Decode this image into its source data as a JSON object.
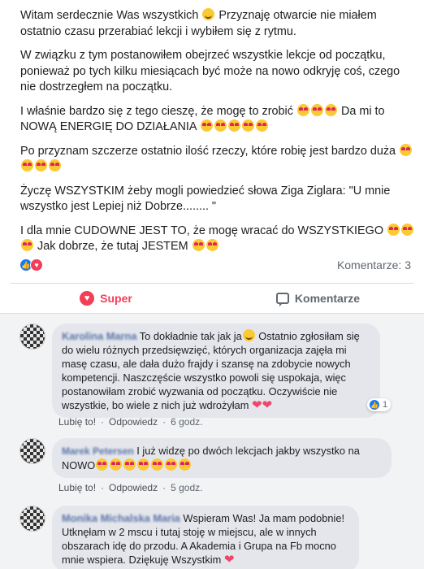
{
  "post": {
    "paragraphs": [
      {
        "before": "Witam serdecznie Was wszystkich ",
        "emoji": "smile",
        "after": " Przyznaję otwarcie nie miałem ostatnio czasu przerabiać lekcji i wybiłem się z rytmu."
      },
      {
        "text": "W związku z tym postanowiłem obejrzeć wszystkie lekcje od początku, ponieważ po tych kilku miesiącach być może na nowo odkryję coś, czego nie dostrzegłem na początku."
      },
      {
        "text": "I właśnie bardzo się z tego cieszę, że mogę to zrobić",
        "emoji_mid": "heart-eyes",
        "mid_count": 3,
        "text2": " Da mi to NOWĄ ENERGIĘ DO DZIAŁANIA ",
        "emoji_end": "heart-eyes",
        "end_count": 5
      },
      {
        "text": "Po przyznam szczerze ostatnio ilość rzeczy, które robię jest bardzo duża ",
        "emoji_end": "heart-eyes",
        "end_count": 4
      },
      {
        "text": "Życzę WSZYSTKIM żeby mogli powiedzieć słowa Ziga Ziglara: \"U mnie wszystko jest Lepiej niż Dobrze........ \""
      },
      {
        "text": "I dla mnie CUDOWNE JEST TO, że mogę wracać do WSZYSTKIEGO ",
        "emoji_mid": "heart-eyes",
        "mid_count": 3,
        "text2": " Jak dobrze, że tutaj JESTEM ",
        "emoji_end": "heart-eyes",
        "end_count": 2
      }
    ],
    "comments_count": "Komentarze: 3"
  },
  "actions": {
    "super_label": "Super",
    "comment_label": "Komentarze"
  },
  "comments": [
    {
      "name": "Karolina Marna",
      "text_before": "To dokładnie tak jak ja",
      "text_after": " Ostatnio zgłosiłam się do wielu różnych przedsięwzięć, których organizacja zajęła mi masę czasu, ale dała dużo frajdy i szansę na zdobycie nowych kompetencji. Naszczęście wszystko powoli się uspokaja, więc postanowiłam zrobić wyzwania od początku. Oczywiście nie wszystkie, bo wiele z nich już wdrożyłam",
      "trailing": "❤❤",
      "reaction_count": "1",
      "like": "Lubię to!",
      "reply": "Odpowiedz",
      "time": "6 godz."
    },
    {
      "name": "Marek Petersen",
      "text": "I już widzę po dwóch lekcjach jakby wszystko na NOWO",
      "emoji_count": 7,
      "like": "Lubię to!",
      "reply": "Odpowiedz",
      "time": "5 godz."
    },
    {
      "name": "Monika Michalska Maria",
      "text": "Wspieram Was! Ja mam podobnie! Utknęłam w 2 mscu i tutaj stoję w miejscu, ale w innych obszarach idę do przodu. A Akademia i Grupa na Fb mocno mnie wspiera. Dziękuję Wszystkim",
      "trailing": "❤"
    }
  ],
  "colors": {
    "link": "#385898",
    "super": "#f33e58",
    "like": "#1877f2"
  }
}
